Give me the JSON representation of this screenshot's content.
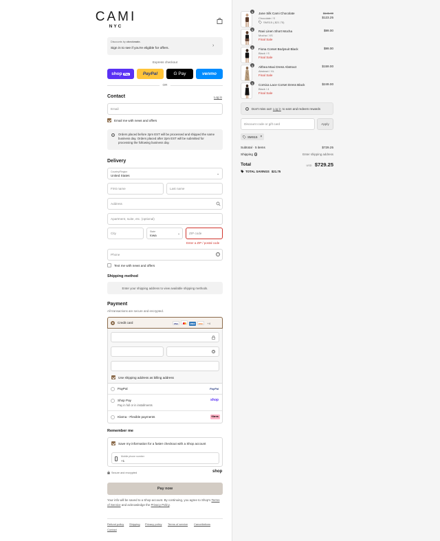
{
  "brand": {
    "name": "CAMI",
    "sub": "NYC"
  },
  "offers": {
    "prefix": "Discounts by",
    "provider": "checkmate.",
    "text": "Sign in to see if you're eligible for offers."
  },
  "express": {
    "label": "Express checkout",
    "or": "OR",
    "shop": "shop",
    "shop_badge": "Pay",
    "paypal": "PayPal",
    "gpay": "G Pay",
    "venmo": "venmo"
  },
  "contact": {
    "title": "Contact",
    "login": "Log in",
    "email_placeholder": "Email",
    "news": "Email me with news and offers",
    "notice": "Orders placed before 2pm EST will be processed and shipped the same business day. Orders placed after 2pm EST will be submitted for processing the following business day."
  },
  "delivery": {
    "title": "Delivery",
    "country_label": "Country/Region",
    "country_value": "United States",
    "first_name": "First name",
    "last_name": "Last name",
    "address": "Address",
    "apartment": "Apartment, suite, etc. (optional)",
    "city": "City",
    "state_label": "State",
    "state_value": "Iowa",
    "zip": "ZIP code",
    "zip_error": "Enter a ZIP / postal code",
    "phone": "Phone",
    "text_news": "Text me with news and offers"
  },
  "shipping": {
    "title": "Shipping method",
    "text": "Enter your shipping address to view available shipping methods."
  },
  "payment": {
    "title": "Payment",
    "subtitle": "All transactions are secure and encrypted.",
    "credit_card": "Credit card",
    "cards_more": "+4",
    "billing": "Use shipping address as billing address",
    "paypal": "PayPal",
    "paypal_logo": "PayPal",
    "shoppay": "Shop Pay",
    "shoppay_sub": "Pay in full or in installments",
    "shoppay_logo": "shop",
    "klarna": "Klarna - Flexible payments",
    "klarna_logo": "Klarna."
  },
  "remember": {
    "title": "Remember me",
    "save": "Save my information for a faster checkout with a Shop account",
    "mobile_label": "Mobile phone number",
    "mobile_value": "+1",
    "secure": "Secure and encrypted",
    "shop": "shop"
  },
  "pay": {
    "button": "Pay now",
    "legal_pre": "Your info will be saved to a Shop account. By continuing, you agree to Shop's",
    "terms": "Terms of Service",
    "and": "and acknowledge the",
    "privacy": "Privacy Policy",
    "dot": "."
  },
  "footer": {
    "links": [
      "Refund policy",
      "Shipping",
      "Privacy policy",
      "Terms of service",
      "Cancellations",
      "Contact"
    ]
  },
  "cart": {
    "items": [
      {
        "qty": "1",
        "name": "Jane Silk Cami Chocolate",
        "variant": "Chocolate / S",
        "discount": "SMS15 (-$21.75)",
        "old_price": "$145.00",
        "price": "$123.25",
        "final": ""
      },
      {
        "qty": "1",
        "name": "Ravi Linen Short Mocha",
        "variant": "Mocha / XS",
        "discount": "",
        "old_price": "",
        "price": "$99.00",
        "final": "Final Sale"
      },
      {
        "qty": "1",
        "name": "Fiona Corset Bodysuit Black",
        "variant": "Black / S",
        "discount": "",
        "old_price": "",
        "price": "$99.00",
        "final": "Final Sale"
      },
      {
        "qty": "1",
        "name": "Althea Maxi Dress Abstract",
        "variant": "Abstract / XL",
        "discount": "",
        "old_price": "",
        "price": "$159.00",
        "final": "Final Sale"
      },
      {
        "qty": "1",
        "name": "Corsica Lace Corset Dress Black",
        "variant": "Black / 4",
        "discount": "",
        "old_price": "",
        "price": "$249.00",
        "final": "Final Sale"
      }
    ],
    "rewards_pre": "Don't miss out!",
    "rewards_link": "Log in",
    "rewards_post": "to earn and redeem rewards",
    "code_placeholder": "Discount code or gift card",
    "apply": "Apply",
    "tag": "SMS15",
    "subtotal_label": "Subtotal · 5 items",
    "subtotal": "$729.25",
    "shipping_label": "Shipping",
    "shipping_value": "Enter shipping address",
    "total_label": "Total",
    "currency": "USD",
    "total": "$729.25",
    "savings_label": "TOTAL SAVINGS",
    "savings": "$21.75"
  },
  "colors": {
    "accent": "#8a6a4a",
    "error": "#d0342c",
    "shop": "#5a31f4",
    "paypal": "#ffc439",
    "venmo": "#008cff"
  }
}
